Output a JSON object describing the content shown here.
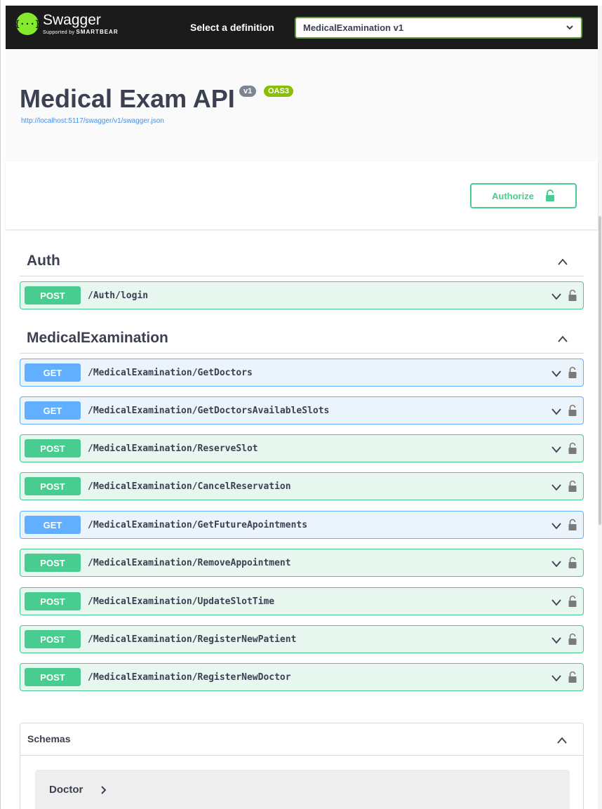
{
  "topbar": {
    "logo_name": "Swagger",
    "logo_sub_prefix": "Supported by",
    "logo_sub_brand": "SMARTBEAR",
    "select_label": "Select a definition",
    "selected_definition": "MedicalExamination v1"
  },
  "info": {
    "title": "Medical Exam API",
    "version_badge": "v1",
    "oas_badge": "OAS3",
    "spec_url": "http://localhost:5117/swagger/v1/swagger.json"
  },
  "scheme": {
    "authorize_label": "Authorize"
  },
  "tags": [
    {
      "name": "Auth"
    },
    {
      "name": "MedicalExamination"
    }
  ],
  "operations": [
    {
      "method": "POST",
      "path": "/Auth/login"
    },
    {
      "method": "GET",
      "path": "/MedicalExamination/GetDoctors"
    },
    {
      "method": "GET",
      "path": "/MedicalExamination/GetDoctorsAvailableSlots"
    },
    {
      "method": "POST",
      "path": "/MedicalExamination/ReserveSlot"
    },
    {
      "method": "POST",
      "path": "/MedicalExamination/CancelReservation"
    },
    {
      "method": "GET",
      "path": "/MedicalExamination/GetFutureApointments"
    },
    {
      "method": "POST",
      "path": "/MedicalExamination/RemoveAppointment"
    },
    {
      "method": "POST",
      "path": "/MedicalExamination/UpdateSlotTime"
    },
    {
      "method": "POST",
      "path": "/MedicalExamination/RegisterNewPatient"
    },
    {
      "method": "POST",
      "path": "/MedicalExamination/RegisterNewDoctor"
    }
  ],
  "schemas": {
    "title": "Schemas",
    "models": [
      {
        "name": "Doctor"
      }
    ]
  },
  "colors": {
    "post": "#49cc90",
    "get": "#61affe",
    "topbar_bg": "#1b1b1b",
    "logo_green": "#85ea2d"
  }
}
